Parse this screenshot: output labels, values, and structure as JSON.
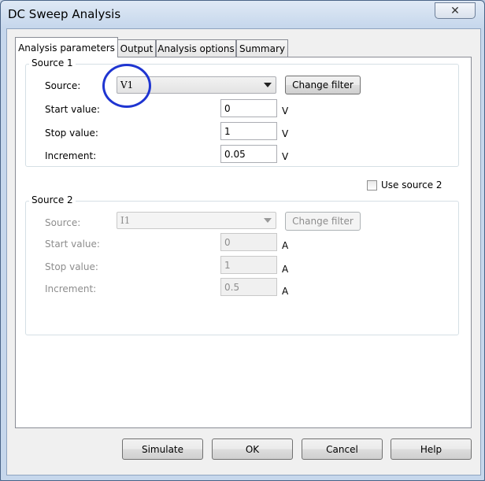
{
  "window": {
    "title": "DC Sweep Analysis",
    "close_glyph": "✕"
  },
  "tabs": [
    {
      "label": "Analysis parameters",
      "active": true
    },
    {
      "label": "Output",
      "active": false
    },
    {
      "label": "Analysis options",
      "active": false
    },
    {
      "label": "Summary",
      "active": false
    }
  ],
  "source1": {
    "group_label": "Source 1",
    "source_label": "Source:",
    "source_value": "V1",
    "change_filter": "Change filter",
    "start_label": "Start value:",
    "start_value": "0",
    "start_unit": "V",
    "stop_label": "Stop value:",
    "stop_value": "1",
    "stop_unit": "V",
    "increment_label": "Increment:",
    "increment_value": "0.05",
    "increment_unit": "V"
  },
  "use_source2": {
    "label": "Use source 2",
    "checked": false
  },
  "source2": {
    "group_label": "Source 2",
    "source_label": "Source:",
    "source_value": "I1",
    "change_filter": "Change filter",
    "start_label": "Start value:",
    "start_value": "0",
    "start_unit": "A",
    "stop_label": "Stop value:",
    "stop_value": "1",
    "stop_unit": "A",
    "increment_label": "Increment:",
    "increment_value": "0.5",
    "increment_unit": "A"
  },
  "buttons": {
    "simulate": "Simulate",
    "ok": "OK",
    "cancel": "Cancel",
    "help": "Help"
  },
  "colors": {
    "annotation_circle": "#1f35d1"
  }
}
